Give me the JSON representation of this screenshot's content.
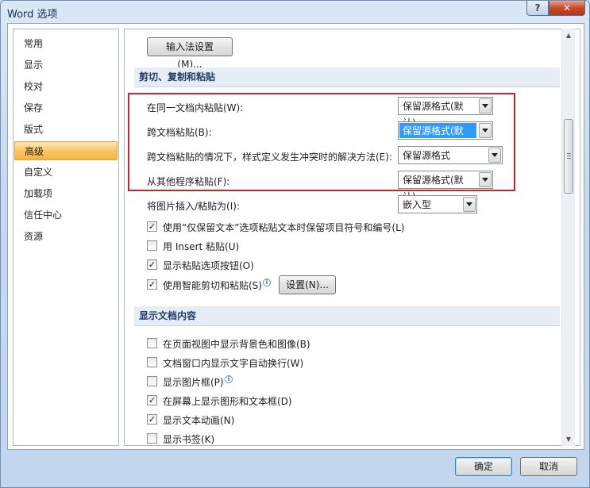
{
  "window": {
    "title": "Word 选项",
    "help": "?",
    "close": "✕"
  },
  "nav": {
    "items": [
      "常用",
      "显示",
      "校对",
      "保存",
      "版式",
      "高级",
      "自定义",
      "加载项",
      "信任中心",
      "资源"
    ],
    "active_index": 5
  },
  "ime_button": "输入法设置(M)...",
  "sections": {
    "paste": "剪切、复制和粘贴",
    "display": "显示文档内容"
  },
  "paste_options": [
    {
      "label": "在同一文档内粘贴(W):",
      "value": "保留源格式(默认)",
      "selected": false
    },
    {
      "label": "跨文档粘贴(B):",
      "value": "保留源格式(默认)",
      "selected": true
    },
    {
      "label": "跨文档粘贴的情况下，样式定义发生冲突时的解决方法(E):",
      "value": "保留源格式",
      "selected": false
    },
    {
      "label": "从其他程序粘贴(F):",
      "value": "保留源格式(默认)",
      "selected": false
    }
  ],
  "insert_picture": {
    "label": "将图片插入/粘贴为(I):",
    "value": "嵌入型"
  },
  "paste_checks": [
    {
      "label": "使用“仅保留文本”选项粘贴文本时保留项目符号和编号(L)",
      "checked": true
    },
    {
      "label": "用 Insert 粘贴(U)",
      "checked": false
    },
    {
      "label": "显示粘贴选项按钮(O)",
      "checked": true
    },
    {
      "label": "使用智能剪切和粘贴(S)",
      "checked": true
    }
  ],
  "settings_button": "设置(N)...",
  "display_checks": [
    {
      "label": "在页面视图中显示背景色和图像(B)",
      "checked": false
    },
    {
      "label": "文档窗口内显示文字自动换行(W)",
      "checked": false
    },
    {
      "label": "显示图片框(P)",
      "checked": false
    },
    {
      "label": "在屏幕上显示图形和文本框(D)",
      "checked": true
    },
    {
      "label": "显示文本动画(N)",
      "checked": true
    },
    {
      "label": "显示书签(K)",
      "checked": false
    }
  ],
  "footer": {
    "ok": "确定",
    "cancel": "取消"
  },
  "check_mark": "✓",
  "info_glyph": "i"
}
